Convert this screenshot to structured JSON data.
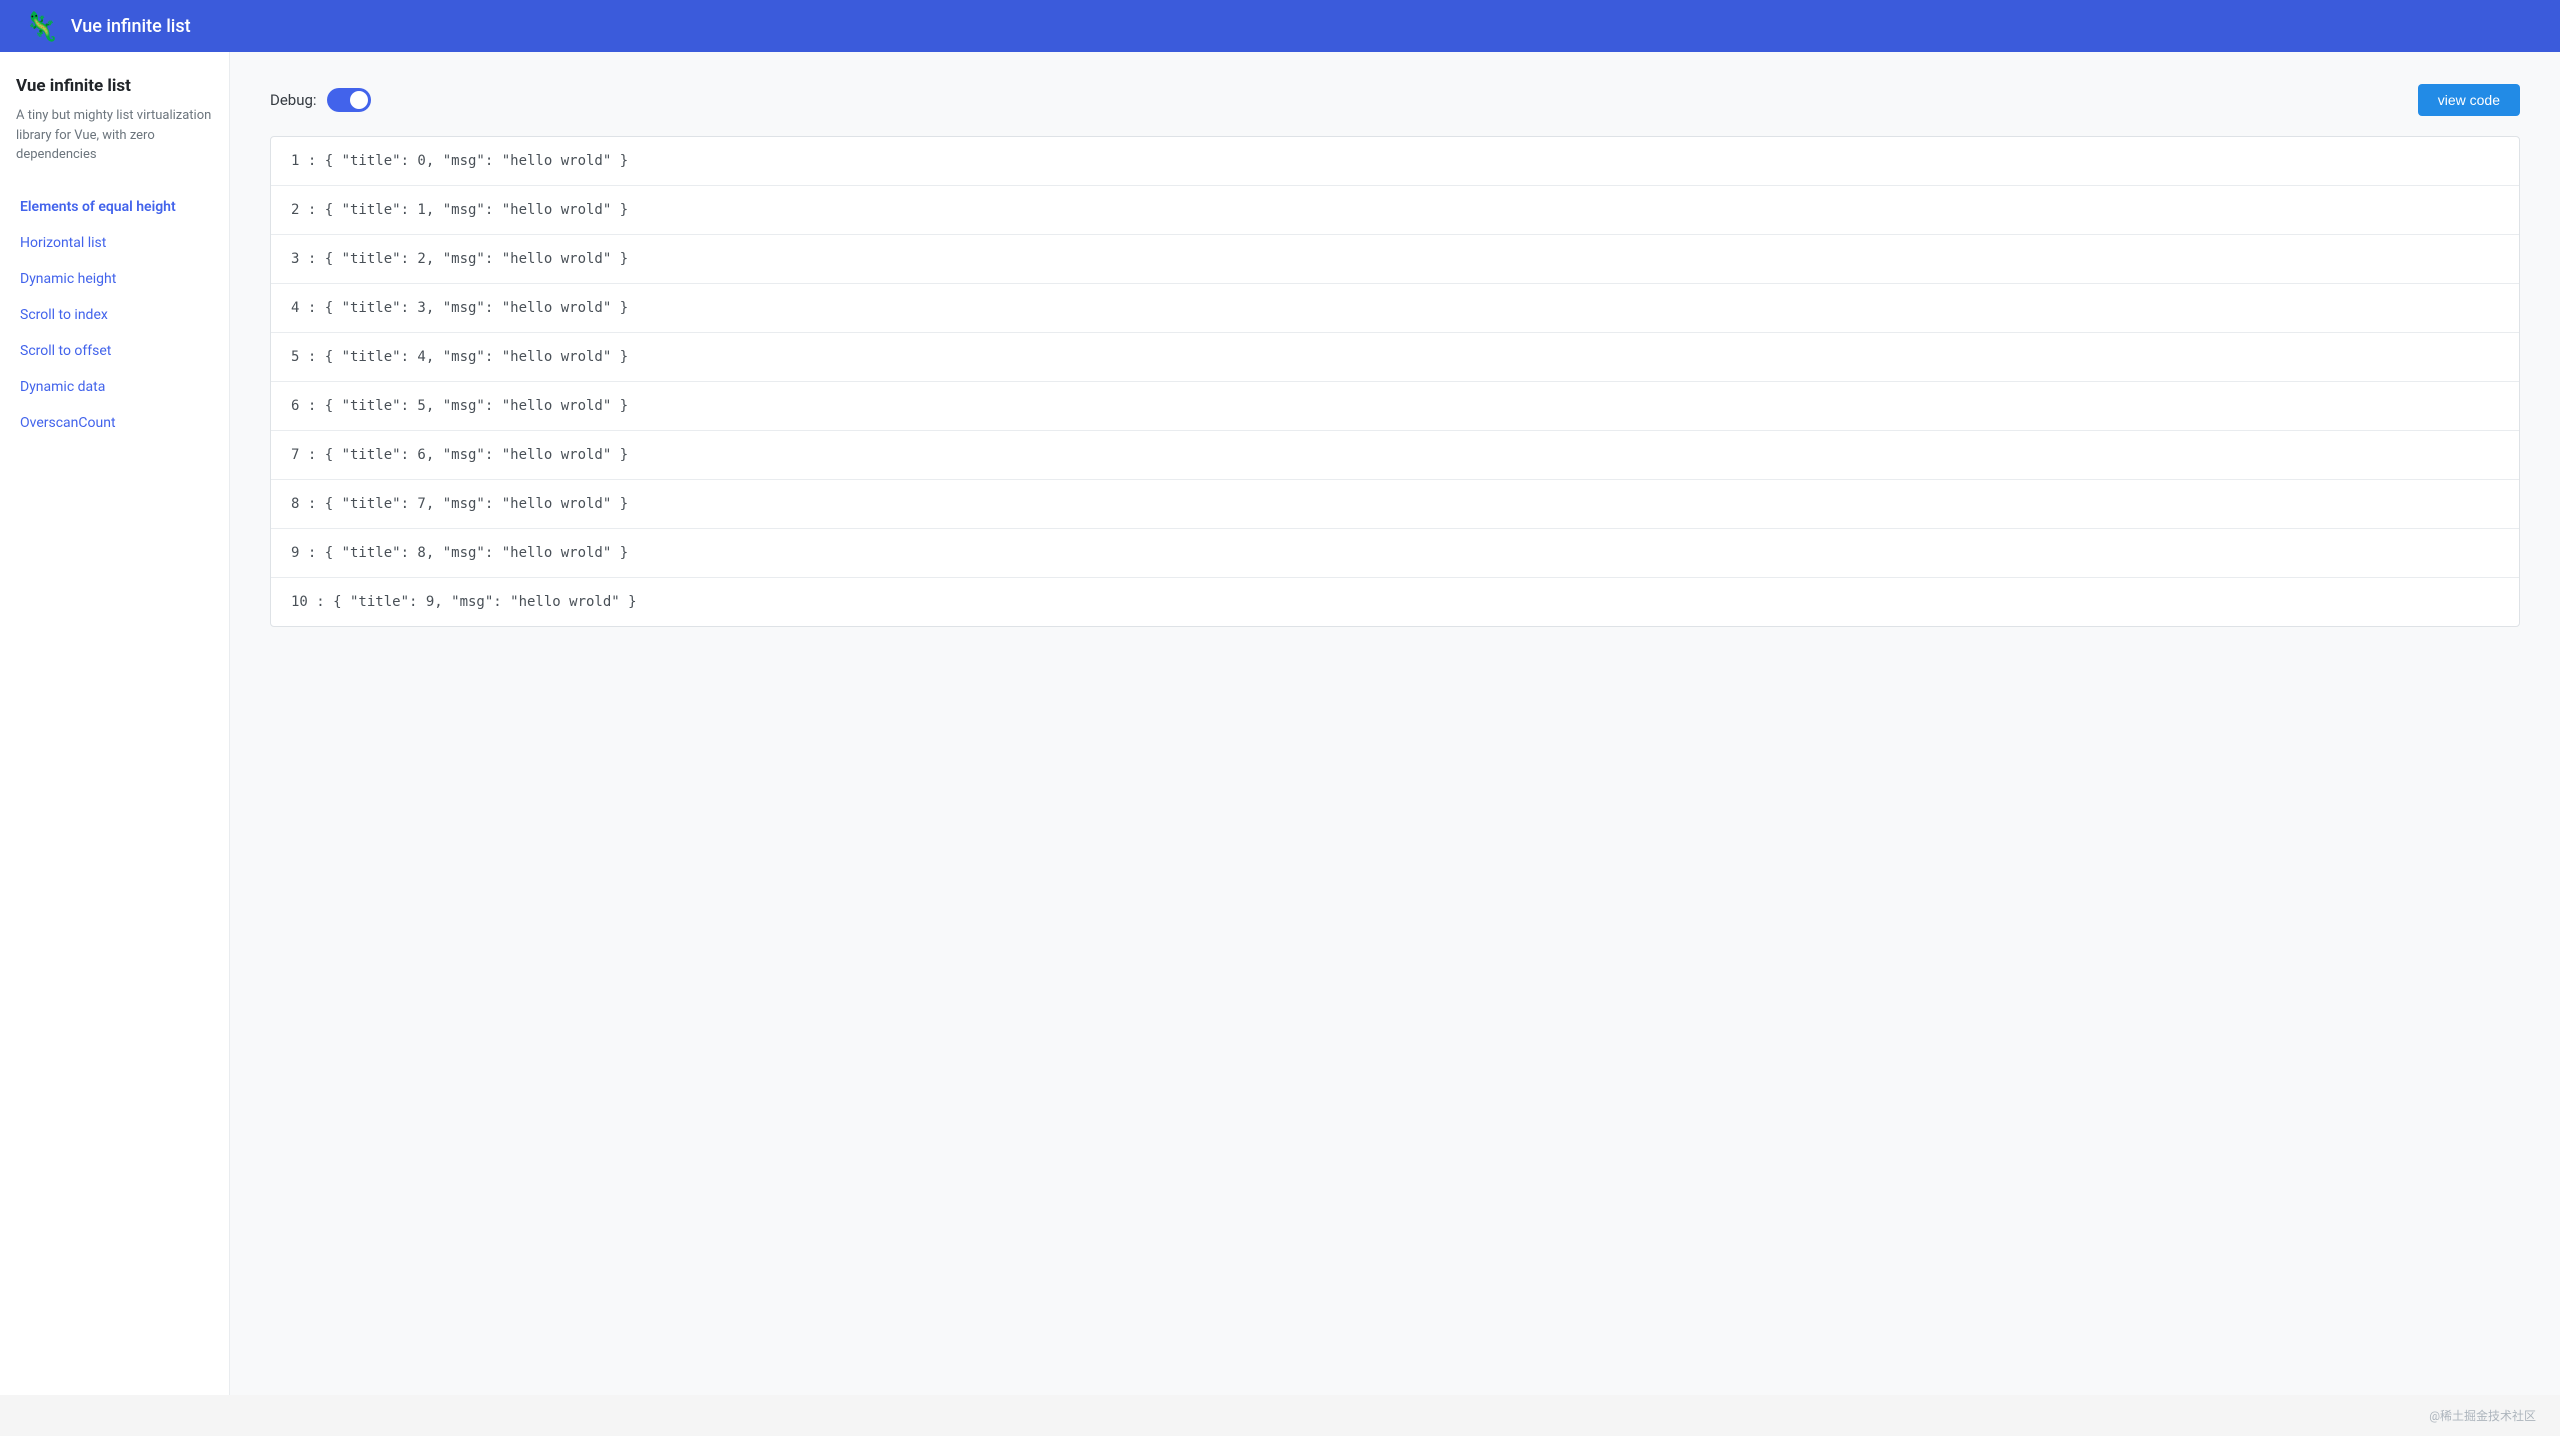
{
  "header": {
    "title": "Vue infinite list",
    "logo_emoji": "🦎"
  },
  "sidebar": {
    "app_title": "Vue infinite list",
    "description": "A tiny but mighty list virtualization library for Vue, with zero dependencies",
    "nav_items": [
      {
        "id": "elements-equal-height",
        "label": "Elements of equal height",
        "active": true
      },
      {
        "id": "horizontal-list",
        "label": "Horizontal list",
        "active": false
      },
      {
        "id": "dynamic-height",
        "label": "Dynamic height",
        "active": false
      },
      {
        "id": "scroll-to-index",
        "label": "Scroll to index",
        "active": false
      },
      {
        "id": "scroll-to-offset",
        "label": "Scroll to offset",
        "active": false
      },
      {
        "id": "dynamic-data",
        "label": "Dynamic data",
        "active": false
      },
      {
        "id": "overscan-count",
        "label": "OverscanCount",
        "active": false
      }
    ]
  },
  "debug": {
    "label": "Debug:",
    "enabled": true
  },
  "view_code_button": {
    "label": "view code"
  },
  "list": {
    "items": [
      {
        "index": 1,
        "data": "{ \"title\": 0, \"msg\": \"hello wrold\" }"
      },
      {
        "index": 2,
        "data": "{ \"title\": 1, \"msg\": \"hello wrold\" }"
      },
      {
        "index": 3,
        "data": "{ \"title\": 2, \"msg\": \"hello wrold\" }"
      },
      {
        "index": 4,
        "data": "{ \"title\": 3, \"msg\": \"hello wrold\" }"
      },
      {
        "index": 5,
        "data": "{ \"title\": 4, \"msg\": \"hello wrold\" }"
      },
      {
        "index": 6,
        "data": "{ \"title\": 5, \"msg\": \"hello wrold\" }"
      },
      {
        "index": 7,
        "data": "{ \"title\": 6, \"msg\": \"hello wrold\" }"
      },
      {
        "index": 8,
        "data": "{ \"title\": 7, \"msg\": \"hello wrold\" }"
      },
      {
        "index": 9,
        "data": "{ \"title\": 8, \"msg\": \"hello wrold\" }"
      },
      {
        "index": 10,
        "data": "{ \"title\": 9, \"msg\": \"hello wrold\" }"
      }
    ]
  },
  "footer": {
    "text": "@稀土掘金技术社区"
  }
}
